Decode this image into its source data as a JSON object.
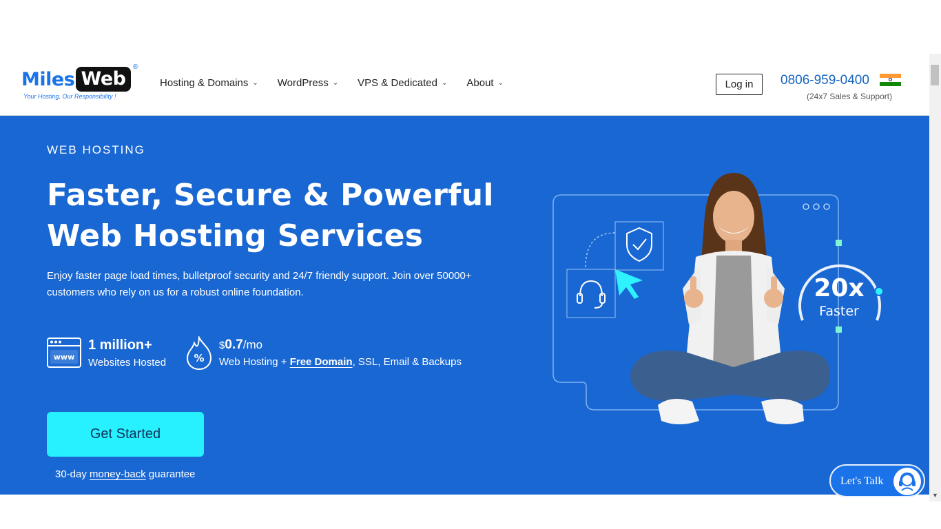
{
  "header": {
    "logo": {
      "miles": "Miles",
      "web": "Web",
      "reg": "®",
      "tagline": "Your Hosting, Our Responsibility !"
    },
    "nav": [
      {
        "label": "Hosting & Domains"
      },
      {
        "label": "WordPress"
      },
      {
        "label": "VPS & Dedicated"
      },
      {
        "label": "About"
      }
    ],
    "login_label": "Log in",
    "phone": "0806-959-0400",
    "support_text": "(24x7 Sales & Support)"
  },
  "hero": {
    "eyebrow": "WEB HOSTING",
    "headline_line1": "Faster, Secure & Powerful",
    "headline_line2": "Web Hosting Services",
    "lead": "Enjoy faster page load times, bulletproof security and 24/7 friendly support. Join over 50000+ customers who rely on us for a robust online foundation.",
    "stat1": {
      "big": "1 million+",
      "small": "Websites Hosted",
      "icon_text": "www"
    },
    "stat2": {
      "currency": "$",
      "price": "0.7",
      "unit": "/mo",
      "small_pre": "Web Hosting + ",
      "small_link": "Free Domain",
      "small_post": ", SSL, Email & Backups"
    },
    "cta_label": "Get Started",
    "guarantee_pre": "30-day ",
    "guarantee_link": "money-back",
    "guarantee_post": " guarantee",
    "illustration": {
      "speed_value": "20x",
      "speed_label": "Faster"
    }
  },
  "chat": {
    "label": "Let's Talk"
  },
  "colors": {
    "hero_bg": "#1967d2",
    "cta": "#27f1ff",
    "brand_blue": "#1a73e8",
    "phone": "#1565c0"
  }
}
